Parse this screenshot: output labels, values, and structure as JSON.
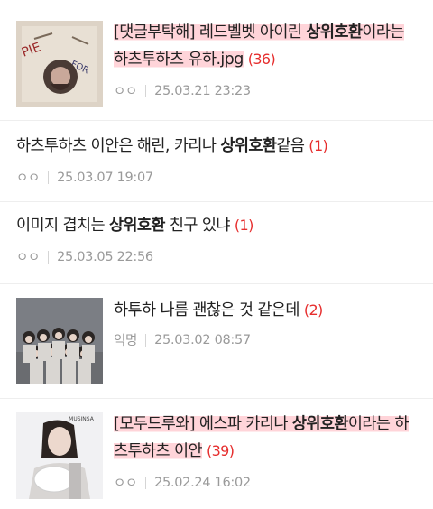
{
  "posts": [
    {
      "tag": "[댓글부탁해]",
      "title_pre": " 레드벨벳 아이린 ",
      "keyword": "상위호환",
      "title_post": "이라는",
      "title_line2": "하츠투하츠 유하.jpg",
      "comments": "(36)",
      "author": "ㅇㅇ",
      "date": "25.03.21 23:23"
    },
    {
      "title_pre": "하츠투하츠 이안은 해린, 카리나 ",
      "keyword": "상위호환",
      "title_post": "같음",
      "comments": "(1)",
      "author": "ㅇㅇ",
      "date": "25.03.07 19:07"
    },
    {
      "title_pre": "이미지 겹치는 ",
      "keyword": "상위호환",
      "title_post": " 친구 있냐",
      "comments": "(1)",
      "author": "ㅇㅇ",
      "date": "25.03.05 22:56"
    },
    {
      "title_pre": "하투하 나름 괜찮은 것 같은데",
      "comments": "(2)",
      "author": "익명",
      "date": "25.03.02 08:57"
    },
    {
      "tag": "[모두드루와]",
      "title_pre": " 에스파 카리나 ",
      "keyword": "상위호환",
      "title_post": "이라는 하",
      "title_line2": "츠투하츠 이안",
      "comments": "(39)",
      "author": "ㅇㅇ",
      "date": "25.02.24 16:02",
      "thumb_text": "MUSINSA"
    }
  ],
  "colors": {
    "highlight": "#ffd4d9",
    "comment_count": "#e62e2e",
    "meta_text": "#9a9a9a"
  }
}
